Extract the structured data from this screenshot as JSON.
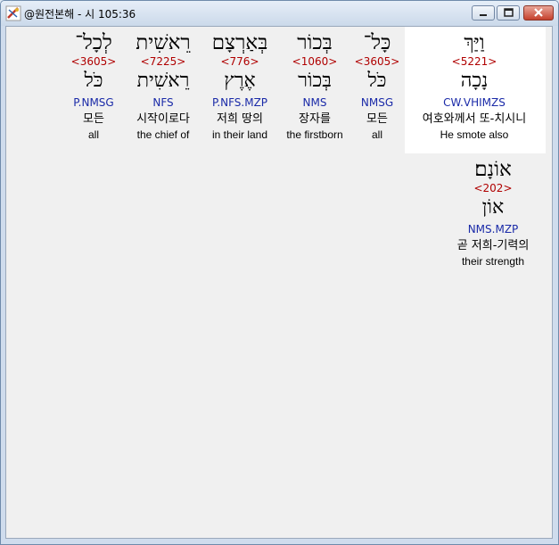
{
  "window": {
    "title": "@원전본해 - 시 105:36"
  },
  "words": [
    {
      "hebrew": "וַיַּךְ",
      "strong": "<5221>",
      "lemma": "נָכָה",
      "morph": "CW.VHIMZS",
      "korean": "여호와께서 또-치시니",
      "english": "He smote also",
      "selected": true
    },
    {
      "hebrew": "כָּל־",
      "strong": "<3605>",
      "lemma": "כֹּל",
      "morph": "NMSG",
      "korean": "모든",
      "english": "all",
      "selected": false
    },
    {
      "hebrew": "בְּכוֹר",
      "strong": "<1060>",
      "lemma": "בְּכוֹר",
      "morph": "NMS",
      "korean": "장자를",
      "english": "the firstborn",
      "selected": false
    },
    {
      "hebrew": "בְּאַרְצָם",
      "strong": "<776>",
      "lemma": "אֶרֶץ",
      "morph": "P.NFS.MZP",
      "korean": "저희 땅의",
      "english": "in their land",
      "selected": false
    },
    {
      "hebrew": "רֵאשִׁית",
      "strong": "<7225>",
      "lemma": "רֵאשִׁית",
      "morph": "NFS",
      "korean": "시작이로다",
      "english": "the chief of",
      "selected": false
    },
    {
      "hebrew": "לְכָל־",
      "strong": "<3605>",
      "lemma": "כֹּל",
      "morph": "P.NMSG",
      "korean": "모든",
      "english": "all",
      "selected": false
    },
    {
      "hebrew": "אוֹנָם׃",
      "strong": "<202>",
      "lemma": "אוֹן",
      "morph": "NMS.MZP",
      "korean": "곧 저희-기력의",
      "english": "their strength",
      "selected": false
    }
  ]
}
